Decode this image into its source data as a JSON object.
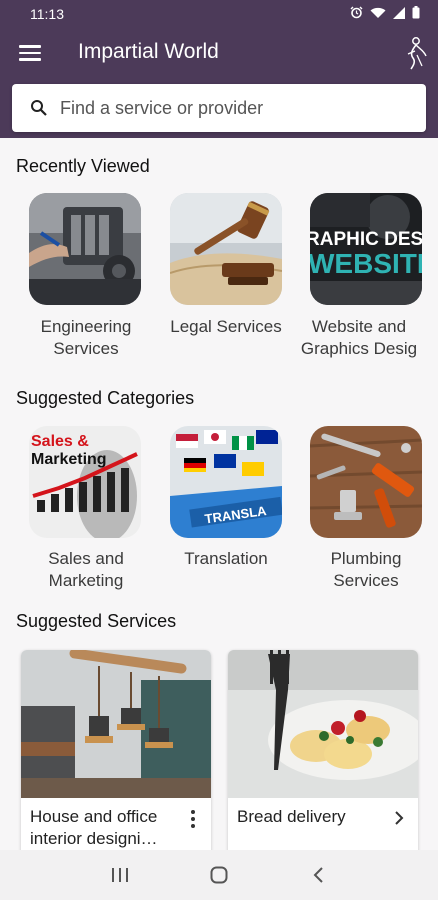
{
  "status_bar": {
    "time": "11:13"
  },
  "app_bar": {
    "title": "Impartial World"
  },
  "search": {
    "placeholder": "Find a service or provider",
    "value": ""
  },
  "recently_viewed": {
    "title": "Recently Viewed",
    "items": [
      {
        "line1": "Engineering",
        "line2": "Services"
      },
      {
        "line1": "Legal Services",
        "line2": ""
      },
      {
        "line1": "Website and",
        "line2": "Graphics Desig"
      }
    ],
    "website_tile_text": {
      "top": "RAPHIC DESI",
      "bottom": "WEBSITE"
    }
  },
  "suggested_categories": {
    "title": "Suggested Categories",
    "items": [
      {
        "line1": "Sales and",
        "line2": "Marketing"
      },
      {
        "line1": "Translation",
        "line2": ""
      },
      {
        "line1": "Plumbing",
        "line2": "Services"
      }
    ],
    "sales_tile_text": {
      "line1": "Sales &",
      "line2": "Marketing"
    },
    "translation_tile_text": "TRANSLA"
  },
  "suggested_services": {
    "title": "Suggested Services",
    "cards": [
      {
        "line1": "House and office",
        "line2": "interior designi…"
      },
      {
        "line1": "Bread delivery",
        "line2": ""
      }
    ]
  },
  "colors": {
    "primary": "#4c3a59",
    "background": "#f7f6f7"
  }
}
